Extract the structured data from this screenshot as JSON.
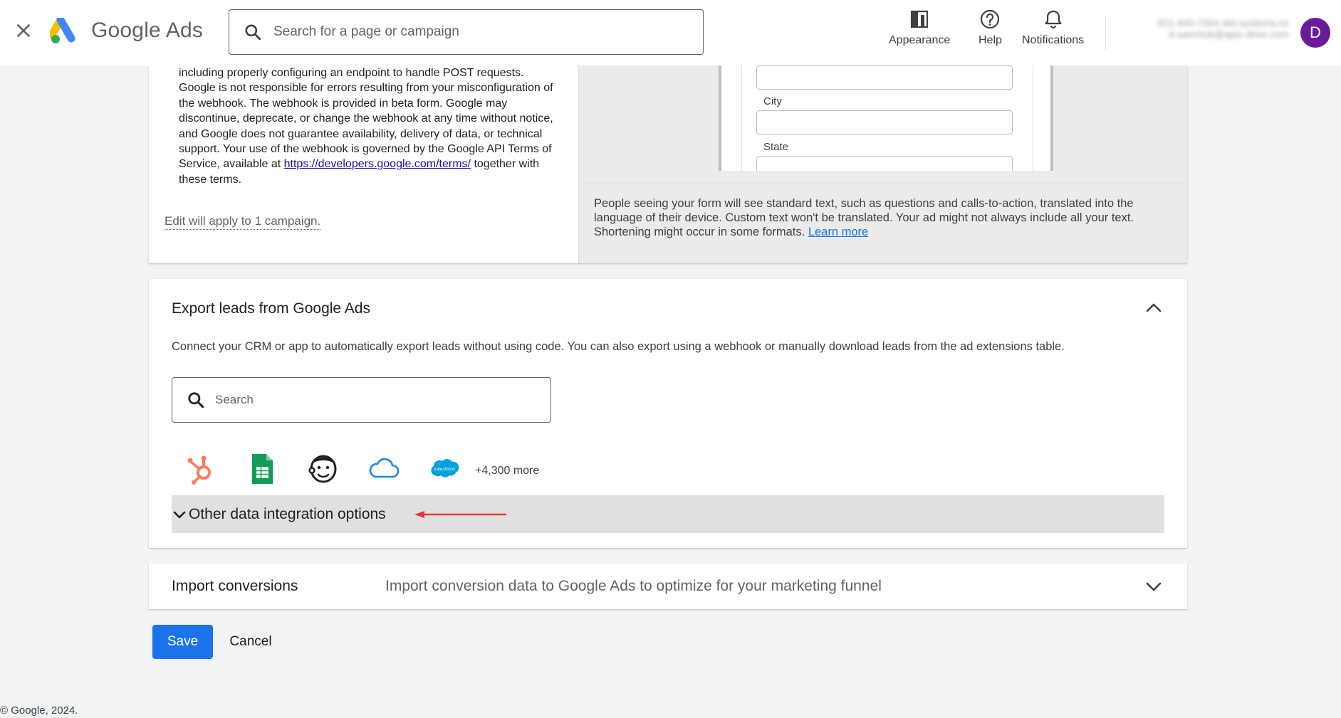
{
  "header": {
    "brand": "Google Ads",
    "search_placeholder": "Search for a page or campaign",
    "actions": [
      {
        "label": "Appearance",
        "icon": "appearance-icon"
      },
      {
        "label": "Help",
        "icon": "help-icon"
      },
      {
        "label": "Notifications",
        "icon": "bell-icon"
      }
    ],
    "account": {
      "line1": "321-440-7264 det-systems.co",
      "line2": "d.sanchuk@apix-drive.com",
      "avatar_letter": "D",
      "avatar_color": "#6a1b9a"
    }
  },
  "webhook_terms": {
    "text_before_link": "including properly configuring an endpoint to handle POST requests. Google is not responsible for errors resulting from your misconfiguration of the webhook. The webhook is provided in beta form. Google may discontinue, deprecate, or change the webhook at any time without notice, and Google does not guarantee availability, delivery of data, or technical support. Your use of the webhook is governed by the Google API Terms of Service, available at ",
    "link": "https://developers.google.com/terms/",
    "text_after_link": " together with these terms.",
    "edit_note": "Edit will apply to 1 campaign."
  },
  "preview": {
    "field_labels": [
      "City",
      "State"
    ],
    "note": "People seeing your form will see standard text, such as questions and calls-to-action, translated into the language of their device. Custom text won't be translated. Your ad might not always include all your text. Shortening might occur in some formats.",
    "learn_more": "Learn more"
  },
  "export": {
    "title": "Export leads from Google Ads",
    "description": "Connect your CRM or app to automatically export leads without using code. You can also export using a webhook or manually download leads from the ad extensions table.",
    "search_placeholder": "Search",
    "integrations": [
      "hubspot-icon",
      "google-sheets-icon",
      "mailchimp-icon",
      "cloud-icon",
      "salesforce-icon"
    ],
    "more_count": "+4,300 more",
    "other_options": "Other data integration options"
  },
  "import": {
    "title": "Import conversions",
    "description": "Import conversion data to Google Ads to optimize for your marketing funnel"
  },
  "buttons": {
    "save": "Save",
    "cancel": "Cancel"
  },
  "footer": {
    "copyright": "© Google, 2024."
  },
  "colors": {
    "primary": "#1a73e8",
    "annotation_arrow": "#e53935"
  }
}
